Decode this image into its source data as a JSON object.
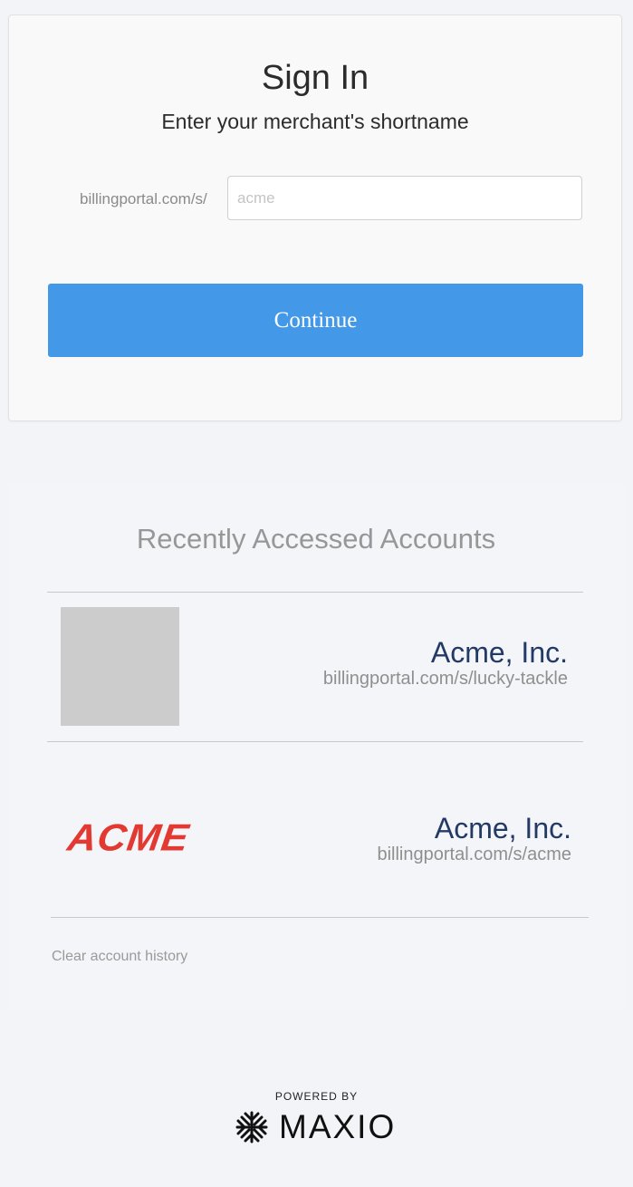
{
  "signin": {
    "title": "Sign In",
    "subtitle": "Enter your merchant's shortname",
    "url_prefix": "billingportal.com/s/",
    "shortname_placeholder": "acme",
    "shortname_value": "",
    "continue_label": "Continue"
  },
  "recent": {
    "title": "Recently Accessed Accounts",
    "accounts": [
      {
        "name": "Acme, Inc.",
        "url": "billingportal.com/s/lucky-tackle",
        "logo": "placeholder-image"
      },
      {
        "name": "Acme, Inc.",
        "url": "billingportal.com/s/acme",
        "logo_text": "ACME"
      }
    ],
    "clear_label": "Clear account history"
  },
  "footer": {
    "powered_by": "POWERED BY",
    "brand": "MAXIO",
    "brand_icon": "maxio-logo-icon"
  },
  "colors": {
    "primary_button": "#4399e8",
    "account_name": "#243a66",
    "acme_logo": "#e23a32"
  }
}
